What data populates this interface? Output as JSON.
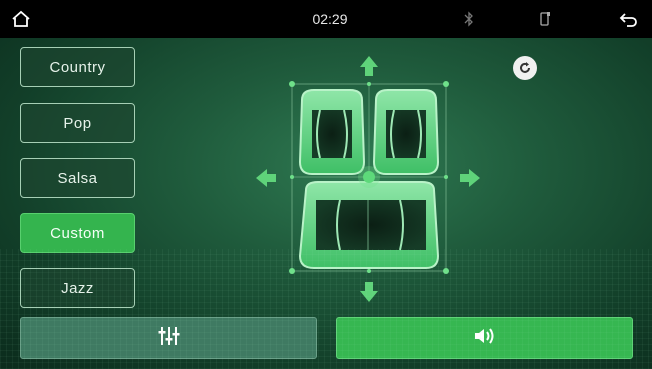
{
  "statusbar": {
    "time": "02:29",
    "icons": [
      "home-icon",
      "bluetooth-icon",
      "phone-connection-icon",
      "back-icon"
    ]
  },
  "presets": [
    {
      "label": "Country",
      "active": false
    },
    {
      "label": "Pop",
      "active": false
    },
    {
      "label": "Salsa",
      "active": false
    },
    {
      "label": "Custom",
      "active": true
    },
    {
      "label": "Jazz",
      "active": false
    }
  ],
  "bottom_buttons": {
    "left_icon": "equalizer-icon",
    "right_icon": "speaker-sound-icon"
  },
  "colors": {
    "accent": "#34b44e",
    "background": "#1f5b3c",
    "statusbar": "#000000"
  }
}
